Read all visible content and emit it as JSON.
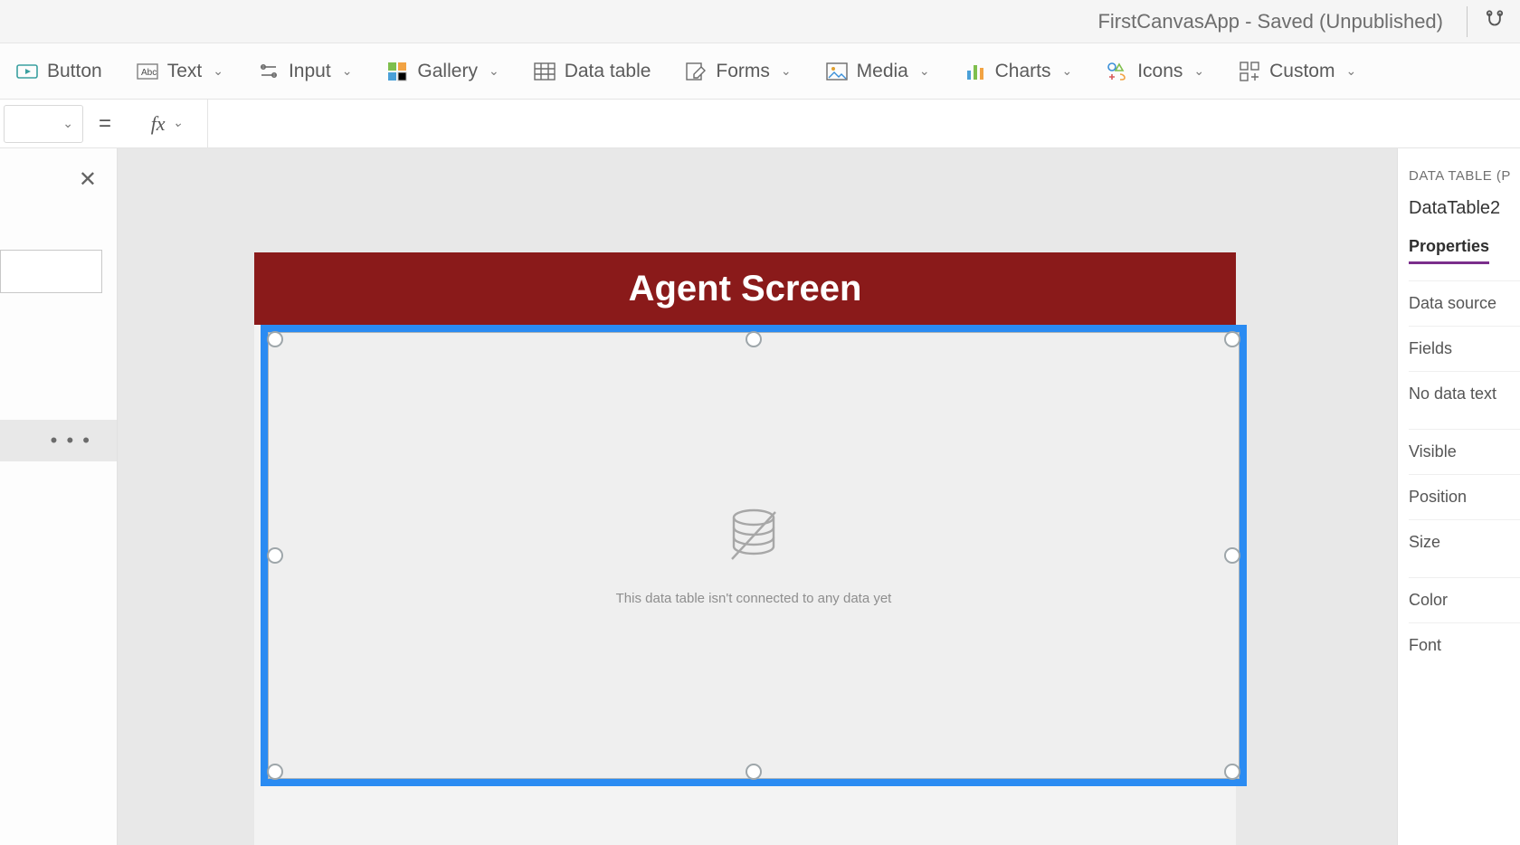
{
  "titlebar": {
    "text": "FirstCanvasApp - Saved (Unpublished)"
  },
  "ribbon": {
    "button": "Button",
    "text": "Text",
    "input": "Input",
    "gallery": "Gallery",
    "datatable": "Data table",
    "forms": "Forms",
    "media": "Media",
    "charts": "Charts",
    "icons": "Icons",
    "custom": "Custom"
  },
  "formula": {
    "fx": "fx",
    "eq": "=",
    "value": ""
  },
  "canvas": {
    "screen_title": "Agent Screen",
    "empty_table_msg": "This data table isn't connected to any data yet"
  },
  "propPanel": {
    "category": "DATA TABLE (P",
    "name": "DataTable2",
    "tab": "Properties",
    "rows": {
      "datasource": "Data source",
      "fields": "Fields",
      "nodata": "No data text",
      "visible": "Visible",
      "position": "Position",
      "size": "Size",
      "color": "Color",
      "font": "Font"
    }
  }
}
